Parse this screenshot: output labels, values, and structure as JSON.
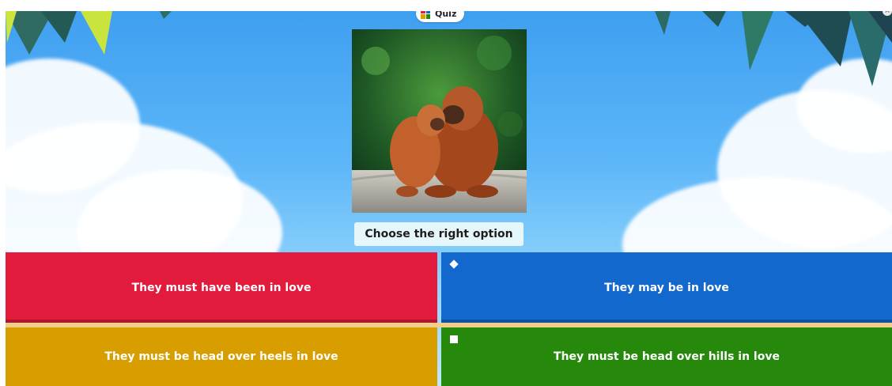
{
  "quiz_badge": {
    "label": "Quiz",
    "icon": "quiz-logo-icon"
  },
  "close_icon": "close-icon",
  "question": {
    "image_alt": "two-orangutans-image",
    "prompt": "Choose the right option"
  },
  "answers": [
    {
      "label": "They must have been in love",
      "shape": "triangle",
      "color": "#e21b3c"
    },
    {
      "label": "They may be in love",
      "shape": "diamond",
      "color": "#1368ce"
    },
    {
      "label": "They must be head over heels in love",
      "shape": "circle",
      "color": "#d89e00"
    },
    {
      "label": "They must be head over hills in love",
      "shape": "square",
      "color": "#26890c"
    }
  ]
}
